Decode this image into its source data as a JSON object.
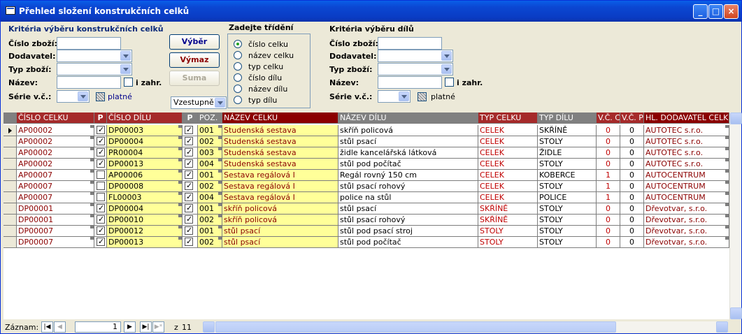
{
  "window": {
    "title": "Přehled složení konstrukčních celků"
  },
  "criteria_left": {
    "heading": "Kritéria výběru konstrukčních celků",
    "cislo_label": "Číslo zboží:",
    "dodavatel_label": "Dodavatel:",
    "typ_label": "Typ zboží:",
    "nazev_label": "Název:",
    "izahr_label": "i zahr.",
    "serie_label": "Série v.č.:",
    "platne_label": "platné"
  },
  "buttons": {
    "vyber": "Výběr",
    "vymaz": "Výmaz",
    "suma": "Suma"
  },
  "sort_order": {
    "value": "Vzestupně"
  },
  "sorting": {
    "heading": "Zadejte třídění",
    "options": [
      "číslo celku",
      "název celku",
      "typ celku",
      "číslo dílu",
      "název dílu",
      "typ dílu"
    ],
    "selected": "číslo celku"
  },
  "criteria_right": {
    "heading": "Kritéria výběru dílů",
    "cislo_label": "Číslo zboží:",
    "dodavatel_label": "Dodavatel:",
    "typ_label": "Typ zboží:",
    "nazev_label": "Název:",
    "izahr_label": "i zahr.",
    "serie_label": "Série v.č.:",
    "platne_label": "platné"
  },
  "table": {
    "headers": [
      "ČÍSLO CELKU",
      "P",
      "ČÍSLO DÍLU",
      "P",
      "POZ.",
      "NÁZEV CELKU",
      "NÁZEV  DÍLU",
      "TYP CELKU",
      "TYP  DÍLU",
      "V.Č. C",
      "V.Č. P",
      "HL. DODAVATEL CELK"
    ],
    "rows": [
      {
        "celek": "AP00002",
        "p1": true,
        "dil": "DP00003",
        "p2": true,
        "poz": "001",
        "nazev_celku": "Studenská sestava",
        "nazev_dilu": "skříň policová",
        "typ_celku": "CELEK",
        "typ_dilu": "SKŘÍNĚ",
        "vcc": "0",
        "vcp": "0",
        "dodavatel": "AUTOTEC s.r.o."
      },
      {
        "celek": "AP00002",
        "p1": true,
        "dil": "DP00004",
        "p2": true,
        "poz": "002",
        "nazev_celku": "Studenská sestava",
        "nazev_dilu": "stůl psací",
        "typ_celku": "CELEK",
        "typ_dilu": "STOLY",
        "vcc": "0",
        "vcp": "0",
        "dodavatel": "AUTOTEC s.r.o."
      },
      {
        "celek": "AP00002",
        "p1": true,
        "dil": "PR00004",
        "p2": true,
        "poz": "003",
        "nazev_celku": "Studenská sestava",
        "nazev_dilu": "židle kancelářská látková",
        "typ_celku": "CELEK",
        "typ_dilu": "ŽIDLE",
        "vcc": "0",
        "vcp": "0",
        "dodavatel": "AUTOTEC s.r.o."
      },
      {
        "celek": "AP00002",
        "p1": true,
        "dil": "DP00013",
        "p2": true,
        "poz": "004",
        "nazev_celku": "Studenská sestava",
        "nazev_dilu": "stůl pod počítač",
        "typ_celku": "CELEK",
        "typ_dilu": "STOLY",
        "vcc": "0",
        "vcp": "0",
        "dodavatel": "AUTOTEC s.r.o."
      },
      {
        "celek": "AP00007",
        "p1": false,
        "dil": "AP00006",
        "p2": true,
        "poz": "001",
        "nazev_celku": "Sestava regálová I",
        "nazev_dilu": "Regál rovný 150 cm",
        "typ_celku": "CELEK",
        "typ_dilu": "KOBERCE",
        "vcc": "1",
        "vcp": "0",
        "dodavatel": "AUTOCENTRUM"
      },
      {
        "celek": "AP00007",
        "p1": false,
        "dil": "DP00008",
        "p2": true,
        "poz": "002",
        "nazev_celku": "Sestava regálová I",
        "nazev_dilu": "stůl psací rohový",
        "typ_celku": "CELEK",
        "typ_dilu": "STOLY",
        "vcc": "1",
        "vcp": "0",
        "dodavatel": "AUTOCENTRUM"
      },
      {
        "celek": "AP00007",
        "p1": false,
        "dil": "FL00003",
        "p2": true,
        "poz": "004",
        "nazev_celku": "Sestava regálová I",
        "nazev_dilu": "police na stůl",
        "typ_celku": "CELEK",
        "typ_dilu": "POLICE",
        "vcc": "1",
        "vcp": "0",
        "dodavatel": "AUTOCENTRUM"
      },
      {
        "celek": "DP00001",
        "p1": true,
        "dil": "DP00004",
        "p2": true,
        "poz": "001",
        "nazev_celku": "skříň policová",
        "nazev_dilu": "stůl psací",
        "typ_celku": "SKŘÍNĚ",
        "typ_dilu": "STOLY",
        "vcc": "0",
        "vcp": "0",
        "dodavatel": "Dřevotvar, s.r.o."
      },
      {
        "celek": "DP00001",
        "p1": true,
        "dil": "DP00010",
        "p2": true,
        "poz": "002",
        "nazev_celku": "skříň policová",
        "nazev_dilu": "stůl psací rohový",
        "typ_celku": "SKŘÍNĚ",
        "typ_dilu": "STOLY",
        "vcc": "0",
        "vcp": "0",
        "dodavatel": "Dřevotvar, s.r.o."
      },
      {
        "celek": "DP00007",
        "p1": true,
        "dil": "DP00012",
        "p2": true,
        "poz": "001",
        "nazev_celku": "stůl psací",
        "nazev_dilu": "stůl pod psací stroj",
        "typ_celku": "STOLY",
        "typ_dilu": "STOLY",
        "vcc": "0",
        "vcp": "0",
        "dodavatel": "Dřevotvar, s.r.o."
      },
      {
        "celek": "DP00007",
        "p1": true,
        "dil": "DP00013",
        "p2": true,
        "poz": "002",
        "nazev_celku": "stůl psací",
        "nazev_dilu": "stůl pod počítač",
        "typ_celku": "STOLY",
        "typ_dilu": "STOLY",
        "vcc": "0",
        "vcp": "0",
        "dodavatel": "Dřevotvar, s.r.o."
      }
    ]
  },
  "navigation": {
    "label": "Záznam:",
    "current": "1",
    "of_label": "z",
    "total": "11"
  }
}
